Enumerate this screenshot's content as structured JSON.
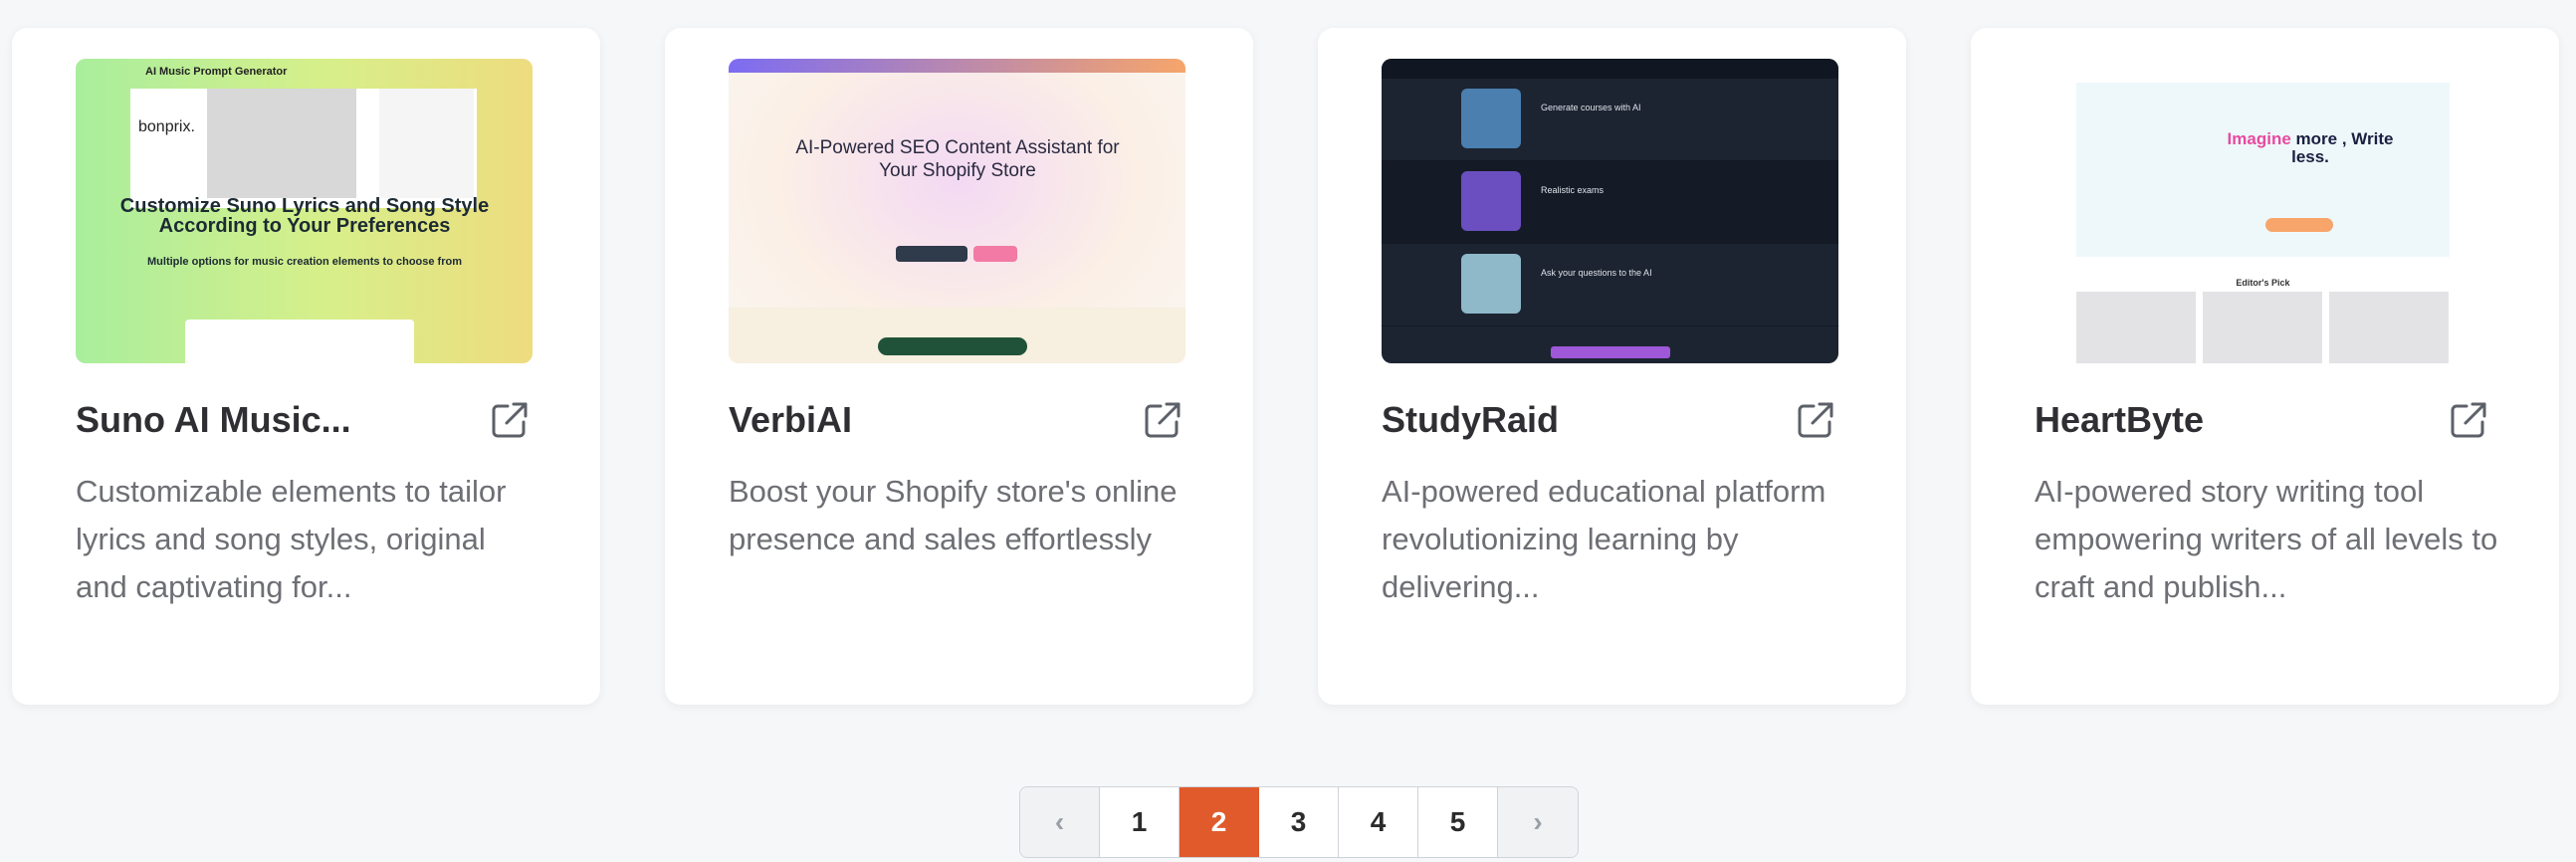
{
  "cards": [
    {
      "title": "Suno AI Music...",
      "description": "Customizable elements to tailor lyrics and song styles, original and captivating for...",
      "thumb": {
        "bar_title": "AI Music Prompt Generator",
        "brand": "bonprix.",
        "headline": "Customize Suno Lyrics and Song Style According to Your Preferences",
        "subline": "Multiple options for music creation elements to choose from"
      }
    },
    {
      "title": "VerbiAI",
      "description": "Boost your Shopify store's online presence and sales effortlessly",
      "thumb": {
        "headline": "AI-Powered SEO Content Assistant for Your Shopify Store"
      }
    },
    {
      "title": "StudyRaid",
      "description": "AI-powered educational platform revolutionizing learning by delivering...",
      "thumb": {
        "rows": [
          "Generate courses with AI",
          "Realistic exams",
          "Ask your questions to the AI"
        ]
      }
    },
    {
      "title": "HeartByte",
      "description": "AI-powered story writing tool empowering writers of all levels to craft and publish...",
      "thumb": {
        "headline_em": "Imagine",
        "headline_rest": " more , Write less.",
        "section": "Editor's Pick"
      }
    }
  ],
  "pagination": {
    "prev": "‹",
    "pages": [
      "1",
      "2",
      "3",
      "4",
      "5"
    ],
    "current": "2",
    "next": "›"
  },
  "icons": {
    "external": "external-link-icon"
  },
  "colors": {
    "accent": "#e05a2b",
    "title": "#2f2f33",
    "description": "#6d6f74"
  }
}
